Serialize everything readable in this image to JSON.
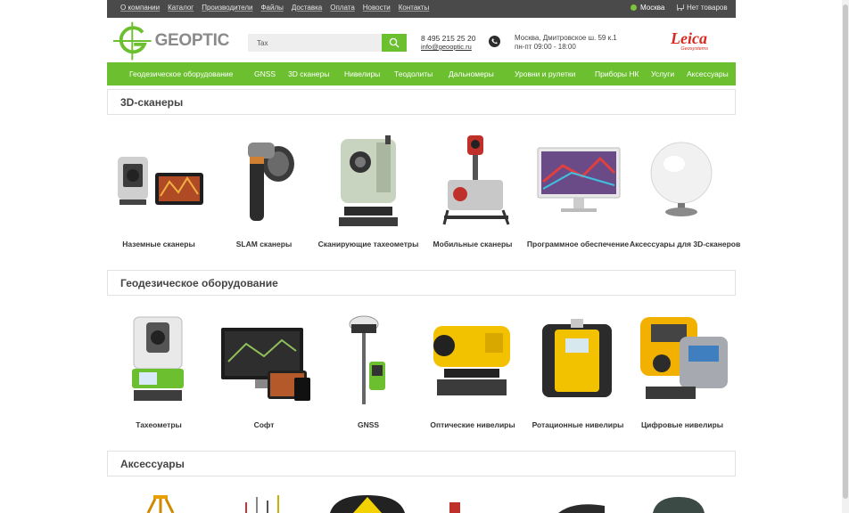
{
  "topbar": {
    "links": [
      "О компании",
      "Каталог",
      "Производители",
      "Файлы",
      "Доставка",
      "Оплата",
      "Новости",
      "Контакты"
    ],
    "city": "Москва",
    "cart": "Нет товаров"
  },
  "header": {
    "logo_text": "GEOPTIC",
    "search_value": "Tax",
    "phone": "8 495 215 25 20",
    "email": "info@geooptic.ru",
    "address": "Москва, Дмитровское ш. 59 к.1",
    "hours": "пн-пт 09:00 - 18:00",
    "brand": "Leica",
    "brand_sub": "Geosystems"
  },
  "nav": [
    "Геодезическое оборудование",
    "GNSS",
    "3D сканеры",
    "Нивелиры",
    "Теодолиты",
    "Дальномеры",
    "Уровни и рулетки",
    "Приборы НК",
    "Услуги",
    "Аксессуары"
  ],
  "sections": [
    {
      "title": "3D-сканеры",
      "items": [
        "Наземные сканеры",
        "SLAM сканеры",
        "Сканирующие тахеометры",
        "Мобильные сканеры",
        "Программное обеспечение",
        "Аксессуары для 3D-сканеров"
      ]
    },
    {
      "title": "Геодезическое оборудование",
      "items": [
        "Тахеометры",
        "Софт",
        "GNSS",
        "Оптические нивелиры",
        "Ротационные нивелиры",
        "Цифровые нивелиры"
      ]
    },
    {
      "title": "Аксессуары",
      "items": []
    }
  ],
  "colors": {
    "accent": "#6cbf2f",
    "topbar": "#4a4a4a",
    "brand_red": "#d52b1e"
  }
}
